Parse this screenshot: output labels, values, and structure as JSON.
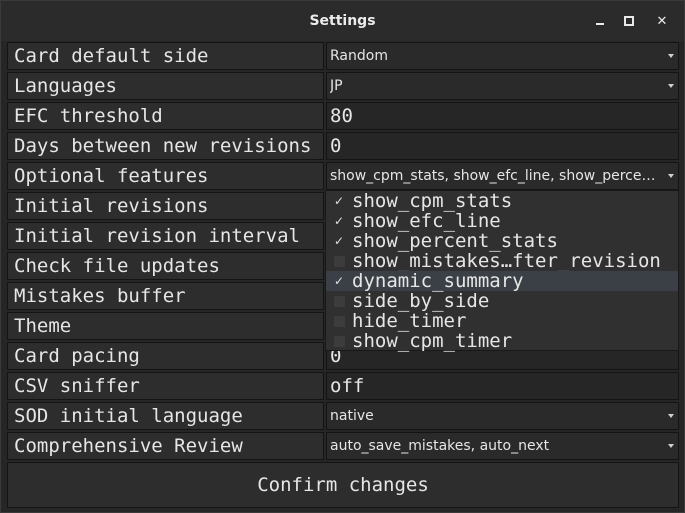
{
  "window": {
    "title": "Settings",
    "minimize_icon": "minimize-icon",
    "maximize_icon": "maximize-icon",
    "close_icon": "close-icon",
    "close_glyph": "✕"
  },
  "settings": [
    {
      "label": "Card default side",
      "value": "Random",
      "kind": "combo"
    },
    {
      "label": "Languages",
      "value": "JP",
      "kind": "combo"
    },
    {
      "label": "EFC threshold",
      "value": "80",
      "kind": "text"
    },
    {
      "label": "Days between new revisions",
      "value": "0",
      "kind": "text"
    },
    {
      "label": "Optional features",
      "value": "show_cpm_stats, show_efc_line, show_percent…",
      "kind": "combo"
    },
    {
      "label": "Initial revisions",
      "value": "",
      "kind": "text"
    },
    {
      "label": "Initial revision interval",
      "value": "",
      "kind": "text"
    },
    {
      "label": "Check file updates",
      "value": "",
      "kind": "text"
    },
    {
      "label": "Mistakes buffer",
      "value": "",
      "kind": "text"
    },
    {
      "label": "Theme",
      "value": "",
      "kind": "text"
    },
    {
      "label": "Card pacing",
      "value": "0",
      "kind": "text"
    },
    {
      "label": "CSV sniffer",
      "value": "off",
      "kind": "text"
    },
    {
      "label": "SOD initial language",
      "value": "native",
      "kind": "combo"
    },
    {
      "label": "Comprehensive Review",
      "value": "auto_save_mistakes, auto_next",
      "kind": "combo"
    }
  ],
  "optional_features_dropdown": {
    "check_glyph": "✓",
    "options": [
      {
        "label": "show_cpm_stats",
        "checked": true,
        "highlighted": false
      },
      {
        "label": "show_efc_line",
        "checked": true,
        "highlighted": false
      },
      {
        "label": "show_percent_stats",
        "checked": true,
        "highlighted": false
      },
      {
        "label": "show_mistakes…fter_revision",
        "checked": false,
        "highlighted": false
      },
      {
        "label": "dynamic_summary",
        "checked": true,
        "highlighted": true
      },
      {
        "label": "side_by_side",
        "checked": false,
        "highlighted": false
      },
      {
        "label": "hide_timer",
        "checked": false,
        "highlighted": false
      },
      {
        "label": "show_cpm_timer",
        "checked": false,
        "highlighted": false
      }
    ]
  },
  "confirm_button": {
    "label": "Confirm changes"
  },
  "colors": {
    "background": "#262626",
    "label_cell": "#2d2d2d",
    "highlight": "#3a4046",
    "text": "#e6e6e6"
  }
}
